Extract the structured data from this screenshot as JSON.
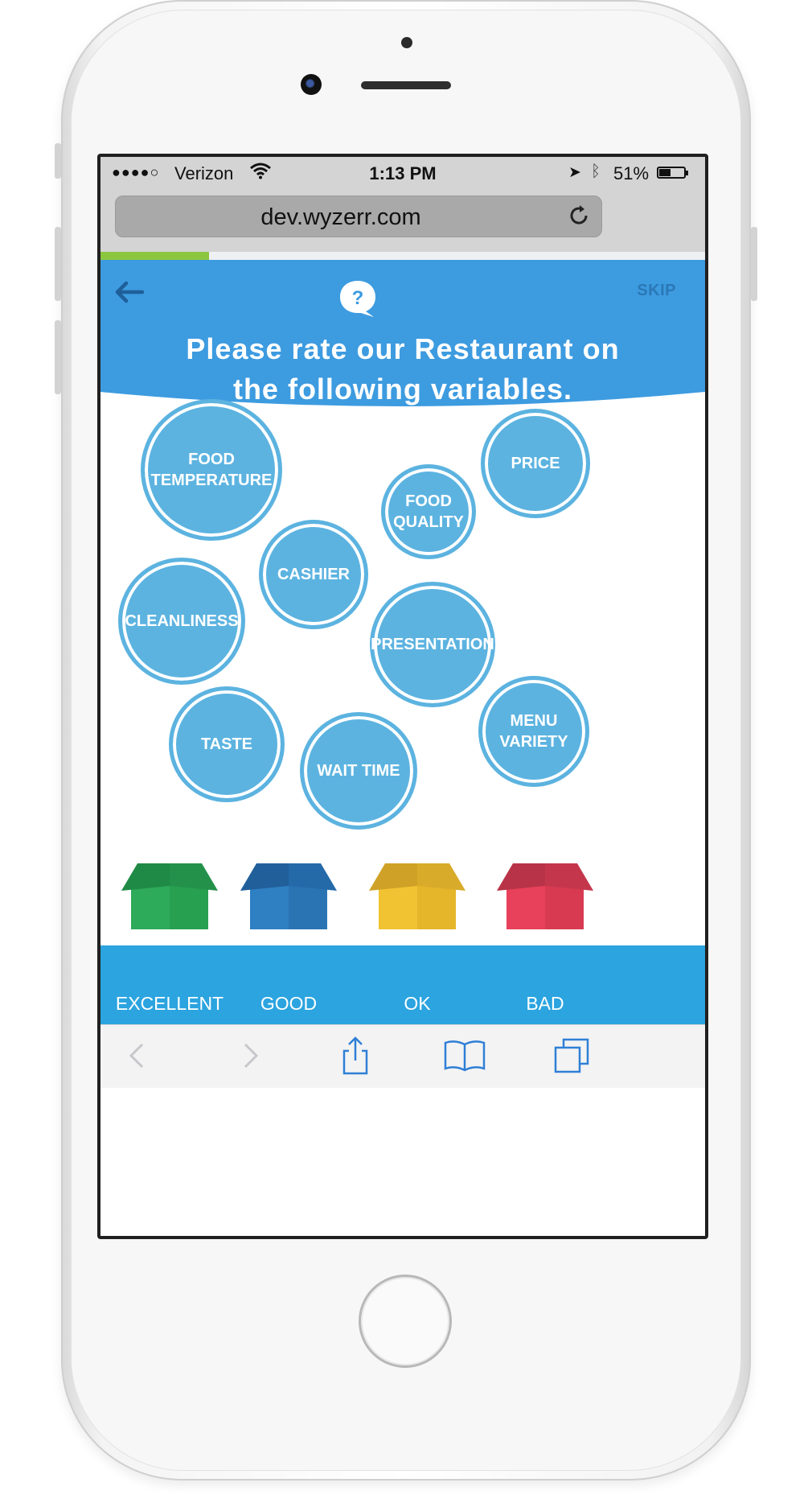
{
  "status_bar": {
    "signal": "●●●●○",
    "carrier": "Verizon",
    "time": "1:13 PM",
    "battery_percent": "51%",
    "battery_level": 0.51
  },
  "browser": {
    "url": "dev.wyzerr.com",
    "progress": 0.18
  },
  "header": {
    "skip_label": "SKIP",
    "title_line1": "Please rate our Restaurant on",
    "title_line2": "the following variables."
  },
  "bubbles": {
    "food_temperature": [
      "FOOD",
      "TEMPERATURE"
    ],
    "price": "PRICE",
    "food_quality": [
      "FOOD",
      "QUALITY"
    ],
    "cashier": "CASHIER",
    "cleanliness": "CLEANLINESS",
    "presentation": "PRESENTATION",
    "menu_variety": [
      "MENU",
      "VARIETY"
    ],
    "taste": "TASTE",
    "wait_time": "WAIT TIME"
  },
  "ratings": [
    {
      "label": "EXCELLENT",
      "color": "#2eaa5b"
    },
    {
      "label": "GOOD",
      "color": "#2f7fc3"
    },
    {
      "label": "OK",
      "color": "#f1c232"
    },
    {
      "label": "BAD",
      "color": "#e8415b"
    }
  ],
  "colors": {
    "header_blue": "#3d9be0",
    "bubble_blue": "#5cb3e0",
    "bin_band": "#2ba4e0",
    "progress_green": "#8cc63f"
  }
}
